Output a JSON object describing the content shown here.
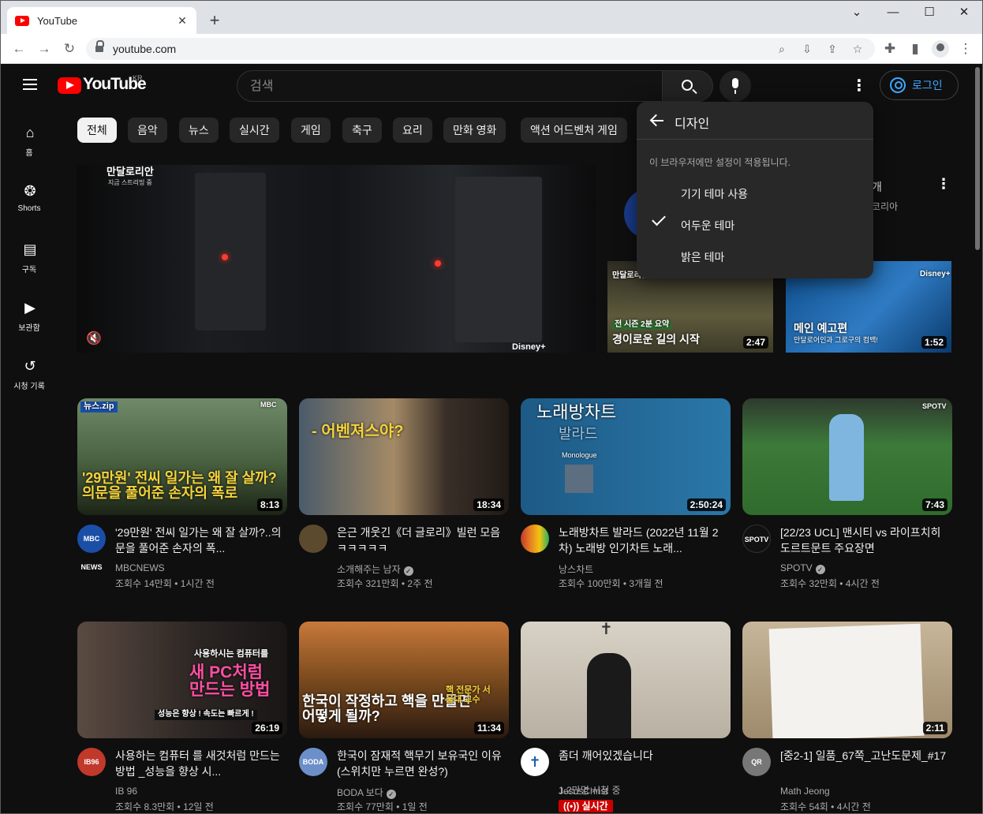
{
  "browser": {
    "tab_title": "YouTube",
    "url": "youtube.com"
  },
  "header": {
    "logo_text": "YouTube",
    "region": "KR",
    "search_placeholder": "검색",
    "login_label": "로그인"
  },
  "sidebar": {
    "items": [
      {
        "label": "홈",
        "icon": "home-icon"
      },
      {
        "label": "Shorts",
        "icon": "shorts-icon"
      },
      {
        "label": "구독",
        "icon": "subscriptions-icon"
      },
      {
        "label": "보관함",
        "icon": "library-icon"
      },
      {
        "label": "시청 기록",
        "icon": "history-icon"
      }
    ]
  },
  "chips": [
    "전체",
    "음악",
    "뉴스",
    "실시간",
    "게임",
    "축구",
    "요리",
    "만화 영화",
    "액션 어드벤처 게임"
  ],
  "hero": {
    "badge": "만달로리안",
    "badge_sub": "지금 스트리밍 중",
    "brand": "Disney+"
  },
  "ad": {
    "title_fragment": "개",
    "sub_fragment": "코리아",
    "thumbs": [
      {
        "badge": "만달로리안",
        "caption_small": "전 시즌 2분 요약",
        "caption": "경이로운 길의 시작",
        "duration": "2:47"
      },
      {
        "brand": "Disney+",
        "caption": "메인 예고편",
        "caption_small": "만달로어인과 그로구의 컴백!",
        "duration": "1:52"
      }
    ]
  },
  "menu": {
    "title": "디자인",
    "note": "이 브라우저에만 설정이 적용됩니다.",
    "options": [
      {
        "label": "기기 테마 사용",
        "selected": false
      },
      {
        "label": "어두운 테마",
        "selected": true
      },
      {
        "label": "밝은 테마",
        "selected": false
      }
    ]
  },
  "videos": [
    {
      "title": "'29만원' 전씨 일가는 왜 잘 살까?..의문을 풀어준 손자의 폭...",
      "channel": "MBCNEWS",
      "verified": false,
      "meta": "조회수 14만회 • 1시간 전",
      "duration": "8:13",
      "thumb_text": "'29만원' 전씨 일가는 왜 잘 살까? 의문을 풀어준 손자의 폭로",
      "thumb_tag": "뉴스.zip",
      "avatar": "MBC NEWS",
      "avatar_color": "#1a4fa8",
      "thumb_color": "#5a6e58"
    },
    {
      "title": "은근 개웃긴《더 글로리》빌런 모음ㅋㅋㅋㅋㅋ",
      "channel": "소개해주는 남자",
      "verified": true,
      "meta": "조회수 321만회 • 2주 전",
      "duration": "18:34",
      "thumb_text": "- 어벤져스야?",
      "avatar": "",
      "avatar_color": "#5b4a2e",
      "thumb_color": "#6b5a45"
    },
    {
      "title": "노래방차트 발라드 (2022년 11월 2차) 노래방 인기차트 노래...",
      "channel": "낭스차트",
      "verified": false,
      "meta": "조회수 100만회 • 3개월 전",
      "duration": "2:50:24",
      "thumb_text": "노래방차트",
      "thumb_sub": "발라드",
      "thumb_tag": "Monologue",
      "avatar": "",
      "avatar_color": "#c0392b",
      "thumb_color": "#1f5f8c"
    },
    {
      "title": "[22/23 UCL] 맨시티 vs 라이프치히 도르트문트 주요장면",
      "channel": "SPOTV",
      "verified": true,
      "meta": "조회수 32만회 • 4시간 전",
      "duration": "7:43",
      "thumb_tag": "SPOTV",
      "avatar": "SPOTV",
      "avatar_color": "#111111",
      "thumb_color": "#3c6b3a"
    },
    {
      "title": "사용하는 컴퓨터 를 새것처럼 만드는 방법 _성능을 향상 시...",
      "channel": "IB 96",
      "verified": false,
      "meta": "조회수 8.3만회 • 12일 전",
      "duration": "26:19",
      "thumb_text": "새 PC처럼 만드는 방법",
      "thumb_tag": "사용하시는 컴퓨터를",
      "thumb_sub": "성능은 향상 ! 속도는 빠르게 !",
      "avatar": "IB96",
      "avatar_color": "#c0392b",
      "thumb_color": "#3a2e2a"
    },
    {
      "title": "한국이 잠재적 핵무기 보유국인 이유 (스위치만 누르면 완성?)",
      "channel": "BODA 보다",
      "verified": true,
      "meta": "조회수 77만회 • 1일 전",
      "duration": "11:34",
      "thumb_text": "한국이 작정하고 핵을 만들면 어떻게 될까?",
      "thumb_tag": "핵 전문가 서울대 교수",
      "avatar": "BODA",
      "avatar_color": "#6c8fc9",
      "thumb_color": "#7a4a1e"
    },
    {
      "title": "좀더 깨어있겠습니다",
      "channel": "JesusChrist",
      "verified": false,
      "meta": "1.2만명 시청 중",
      "live": "실시간",
      "avatar": "✝",
      "avatar_color": "#1f5fa8",
      "thumb_color": "#c9c2b5"
    },
    {
      "title": "[중2-1] 일품_67쪽_고난도문제_#17",
      "channel": "Math Jeong",
      "verified": false,
      "meta": "조회수 54회 • 4시간 전",
      "duration": "2:11",
      "avatar": "QR",
      "avatar_color": "#777777",
      "thumb_color": "#b9a98f"
    }
  ]
}
